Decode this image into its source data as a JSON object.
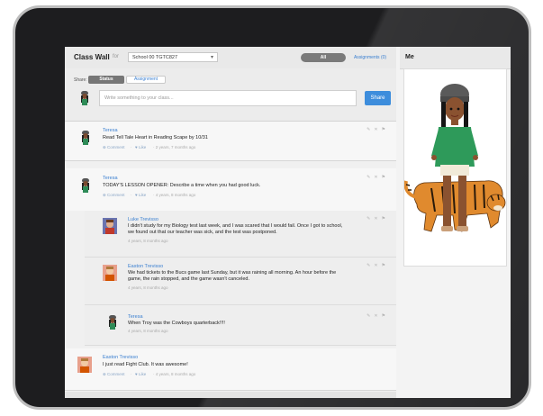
{
  "header": {
    "title": "Class Wall",
    "for_text": "for",
    "class_select": "School 00 TGTC827",
    "tab_all": "All",
    "tab_assignments": "Assignments (0)"
  },
  "share": {
    "label": "Share:",
    "status_tab": "Status",
    "assignment_tab": "Assignment",
    "placeholder": "Write something to your class...",
    "button": "Share"
  },
  "posts": [
    {
      "author": "Teresa",
      "text": "Read Tell Tale Heart in Reading Scape by 10/31",
      "comment": "Comment",
      "like": "Like",
      "time": "2 years, 7 months ago"
    },
    {
      "author": "Teresa",
      "text": "TODAY'S LESSON OPENER: Describe a time when you had good luck.",
      "comment": "Comment",
      "like": "Like",
      "time": "4 years, 8 months ago",
      "replies": [
        {
          "author": "Luke Trevisso",
          "text1": "I didn't study for my Biology test last week, and I was scared that I would fail. Once I got to school,",
          "text2": "we found out that our teacher was sick, and the test was postponed.",
          "time": "4 years, 8 months ago"
        },
        {
          "author": "Easton Trevisso",
          "text1": "We had tickets to the Bucs game last Sunday, but it was raining all morning. An hour before the",
          "text2": "game, the rain stopped, and the game wasn't canceled.",
          "time": "4 years, 8 months ago"
        },
        {
          "author": "Teresa",
          "text1": "When Troy was the Cowboys quarterback!!!!",
          "text2": "",
          "time": "4 years, 8 months ago"
        }
      ]
    },
    {
      "author": "Easton Trevisso",
      "text": "I just read Fight Club. It was awesome!",
      "comment": "Comment",
      "like": "Like",
      "time": "4 years, 8 months ago"
    }
  ],
  "sidebar": {
    "title": "Me"
  },
  "icons": {
    "edit": "pencil-icon",
    "delete": "close-icon",
    "flag": "flag-icon"
  },
  "colors": {
    "link": "#3a7fd0",
    "share_button": "#3d8ddc",
    "bezel": "#1d1d1f"
  }
}
